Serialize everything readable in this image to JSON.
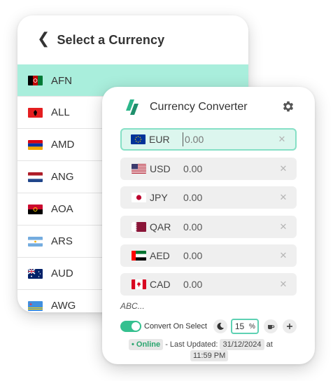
{
  "currency_list": {
    "title": "Select a Currency",
    "items": [
      {
        "code": "AFN",
        "selected": true
      },
      {
        "code": "ALL",
        "selected": false
      },
      {
        "code": "AMD",
        "selected": false
      },
      {
        "code": "ANG",
        "selected": false
      },
      {
        "code": "AOA",
        "selected": false
      },
      {
        "code": "ARS",
        "selected": false
      },
      {
        "code": "AUD",
        "selected": false
      },
      {
        "code": "AWG",
        "selected": false
      }
    ]
  },
  "converter": {
    "title": "Currency Converter",
    "rows": [
      {
        "code": "EUR",
        "amount": "0.00",
        "active": true
      },
      {
        "code": "USD",
        "amount": "0.00",
        "active": false
      },
      {
        "code": "JPY",
        "amount": "0.00",
        "active": false
      },
      {
        "code": "QAR",
        "amount": "0.00",
        "active": false
      },
      {
        "code": "AED",
        "amount": "0.00",
        "active": false
      },
      {
        "code": "CAD",
        "amount": "0.00",
        "active": false
      }
    ],
    "abc_label": "ABC...",
    "convert_on_select": {
      "label": "Convert On Select",
      "enabled": true
    },
    "percent": {
      "value": "15",
      "unit": "%"
    },
    "status": {
      "online": "• Online",
      "text": " - Last Updated: ",
      "date": "31/12/2024",
      "at": " at",
      "time": "11:59 PM"
    }
  },
  "colors": {
    "selected_row": "#a9eedc",
    "accent": "#35c08f",
    "active_border": "#86e0c6"
  },
  "icons": [
    "chevron-left-icon",
    "app-logo-icon",
    "gear-icon",
    "close-icon",
    "moon-icon",
    "coffee-icon",
    "plus-icon"
  ]
}
